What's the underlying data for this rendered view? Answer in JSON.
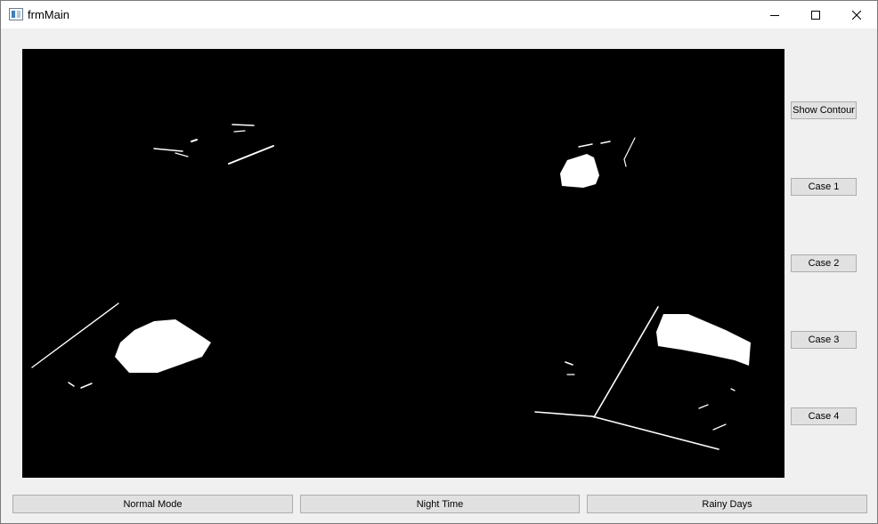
{
  "window": {
    "title": "frmMain",
    "icon": "app-icon"
  },
  "title_buttons": {
    "minimize": "minimize-icon",
    "maximize": "maximize-icon",
    "close": "close-icon"
  },
  "side_buttons": {
    "show_contour": "Show Contour",
    "case1": "Case 1",
    "case2": "Case 2",
    "case3": "Case 3",
    "case4": "Case 4"
  },
  "bottom_buttons": {
    "normal_mode": "Normal Mode",
    "night_time": "Night Time",
    "rainy_days": "Rainy Days"
  },
  "picture": {
    "description_colors": {
      "background": "#000000",
      "foreground": "#ffffff"
    }
  }
}
